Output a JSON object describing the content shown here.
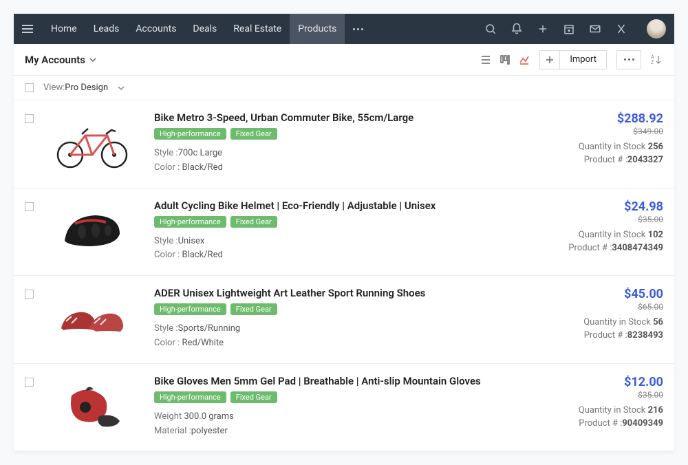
{
  "nav": {
    "items": [
      "Home",
      "Leads",
      "Accounts",
      "Deals",
      "Real Estate",
      "Products"
    ],
    "activeIndex": 5
  },
  "subbar": {
    "title": "My Accounts",
    "importLabel": "Import"
  },
  "filter": {
    "viewLabel": "View:",
    "viewValue": "Pro Design"
  },
  "labels": {
    "style": "Style :",
    "color": "Color : ",
    "weight": "Weight ",
    "material": "Material :",
    "stock": "Quantity in Stock ",
    "productNum": "Product # :"
  },
  "products": [
    {
      "title": "Bike Metro 3-Speed, Urban Commuter Bike, 55cm/Large",
      "tags": [
        "High-performance",
        "Fixed Gear"
      ],
      "attrs": [
        {
          "k": "style",
          "v": "700c Large"
        },
        {
          "k": "color",
          "v": "Black/Red"
        }
      ],
      "price": "$288.92",
      "old_price": "$349.00",
      "stock": "256",
      "product_num": "2043327",
      "image": "bike"
    },
    {
      "title": "Adult Cycling Bike Helmet | Eco-Friendly | Adjustable | Unisex",
      "tags": [
        "High-performance",
        "Fixed Gear"
      ],
      "attrs": [
        {
          "k": "style",
          "v": "Unisex"
        },
        {
          "k": "color",
          "v": "Black/Red"
        }
      ],
      "price": "$24.98",
      "old_price": "$35.00",
      "stock": "102",
      "product_num": "3408474349",
      "image": "helmet"
    },
    {
      "title": "ADER Unisex Lightweight Art Leather Sport Running Shoes",
      "tags": [
        "High-performance",
        "Fixed Gear"
      ],
      "attrs": [
        {
          "k": "style",
          "v": "Sports/Running"
        },
        {
          "k": "color",
          "v": "Red/White"
        }
      ],
      "price": "$45.00",
      "old_price": "$65.00",
      "stock": "56",
      "product_num": "8238493",
      "image": "shoes"
    },
    {
      "title": "Bike Gloves Men 5mm Gel Pad | Breathable | Anti-slip Mountain Gloves",
      "tags": [
        "High-performance",
        "Fixed Gear"
      ],
      "attrs": [
        {
          "k": "weight",
          "v": "300.0 grams"
        },
        {
          "k": "material",
          "v": "polyester"
        }
      ],
      "price": "$12.00",
      "old_price": "$35.00",
      "stock": "216",
      "product_num": "90409349",
      "image": "gloves"
    }
  ]
}
